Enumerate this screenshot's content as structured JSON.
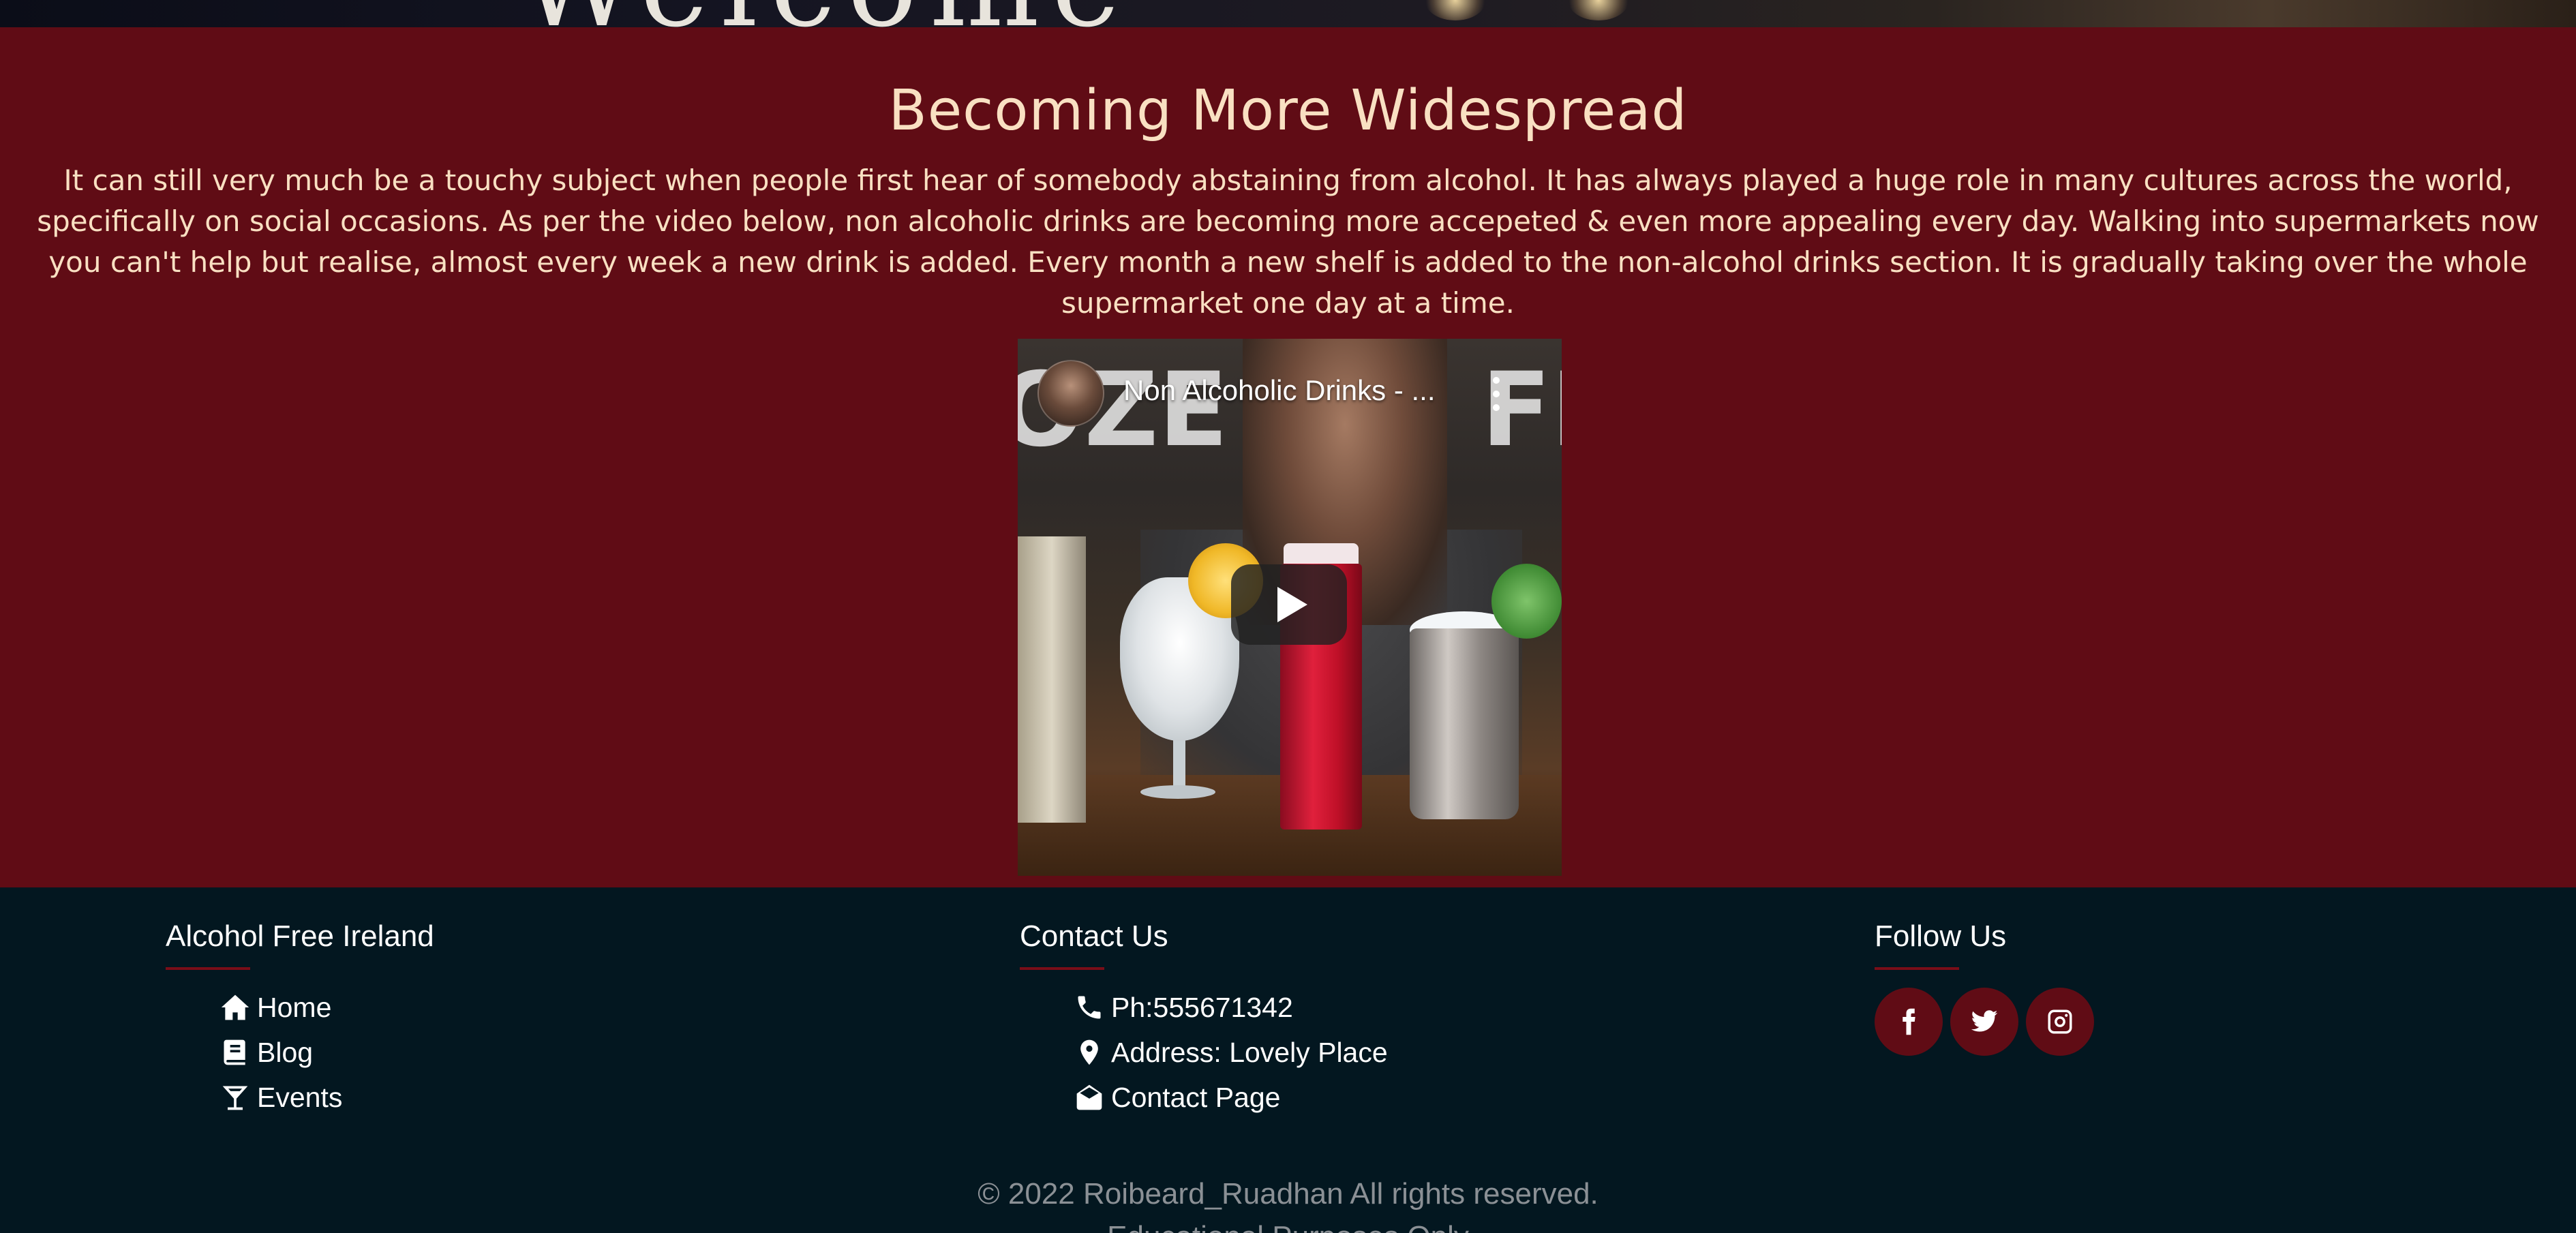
{
  "hero": {
    "text": "Welcome"
  },
  "section": {
    "heading": "Becoming More Widespread",
    "paragraph": "It can still very much be a touchy subject when people first hear of somebody abstaining from alcohol. It has always played a huge role in many cultures across the world, specifically on social occasions. As per the video below, non alcoholic drinks are becoming more accepeted & even more appealing every day. Walking into supermarkets now you can't help but realise, almost every week a new drink is added. Every month a new shelf is added to the non-alcohol drinks section. It is gradually taking over the whole supermarket one day at a time."
  },
  "video": {
    "title": "Non Alcoholic Drinks - ...",
    "bg_left": "OZE",
    "bg_right": "FI",
    "icons": [
      "avatar",
      "kebab-menu-icon",
      "play-icon"
    ]
  },
  "footer": {
    "brand": {
      "heading": "Alcohol Free Ireland",
      "links": [
        {
          "icon": "home-icon",
          "label": "Home"
        },
        {
          "icon": "book-icon",
          "label": "Blog"
        },
        {
          "icon": "cocktail-icon",
          "label": "Events"
        }
      ]
    },
    "contact": {
      "heading": "Contact Us",
      "items": [
        {
          "icon": "phone-icon",
          "label": "Ph:555671342"
        },
        {
          "icon": "map-pin-icon",
          "label": "Address: Lovely Place"
        },
        {
          "icon": "envelope-open-icon",
          "label": "Contact Page"
        }
      ]
    },
    "follow": {
      "heading": "Follow Us",
      "socials": [
        "facebook-icon",
        "twitter-icon",
        "instagram-icon"
      ]
    },
    "copyright": "© 2022 Roibeard_Ruadhan All rights reserved.",
    "note": "Educational Purposes Only"
  },
  "colors": {
    "maroon": "#600c15",
    "cream": "#f9e0c2",
    "navy": "#031720",
    "muted": "#8b9095"
  }
}
